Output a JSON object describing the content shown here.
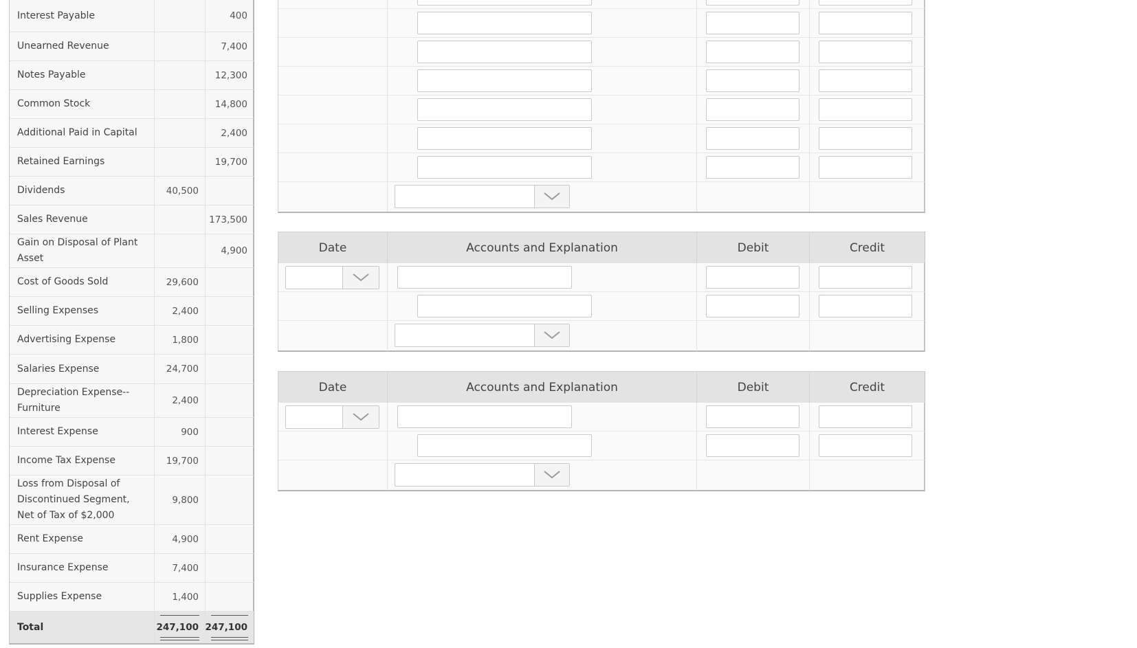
{
  "trial_balance": {
    "rows": [
      {
        "name": "Interest Payable",
        "debit": "",
        "credit": "400"
      },
      {
        "name": "Unearned Revenue",
        "debit": "",
        "credit": "7,400"
      },
      {
        "name": "Notes Payable",
        "debit": "",
        "credit": "12,300"
      },
      {
        "name": "Common Stock",
        "debit": "",
        "credit": "14,800"
      },
      {
        "name": "Additional Paid in Capital",
        "debit": "",
        "credit": "2,400"
      },
      {
        "name": "Retained Earnings",
        "debit": "",
        "credit": "19,700"
      },
      {
        "name": "Dividends",
        "debit": "40,500",
        "credit": ""
      },
      {
        "name": "Sales Revenue",
        "debit": "",
        "credit": "173,500"
      },
      {
        "name": "Gain on Disposal of Plant Asset",
        "debit": "",
        "credit": "4,900"
      },
      {
        "name": "Cost of Goods Sold",
        "debit": "29,600",
        "credit": ""
      },
      {
        "name": "Selling Expenses",
        "debit": "2,400",
        "credit": ""
      },
      {
        "name": "Advertising Expense",
        "debit": "1,800",
        "credit": ""
      },
      {
        "name": "Salaries Expense",
        "debit": "24,700",
        "credit": ""
      },
      {
        "name": "Depreciation Expense--Furniture",
        "debit": "2,400",
        "credit": ""
      },
      {
        "name": "Interest Expense",
        "debit": "900",
        "credit": ""
      },
      {
        "name": "Income Tax Expense",
        "debit": "19,700",
        "credit": ""
      },
      {
        "name": "Loss from Disposal of Discontinued Segment, Net of Tax of $2,000",
        "debit": "9,800",
        "credit": ""
      },
      {
        "name": "Rent Expense",
        "debit": "4,900",
        "credit": ""
      },
      {
        "name": "Insurance Expense",
        "debit": "7,400",
        "credit": ""
      },
      {
        "name": "Supplies Expense",
        "debit": "1,400",
        "credit": ""
      }
    ],
    "total": {
      "name": "Total",
      "debit": "247,100",
      "credit": "247,100"
    }
  },
  "journal": {
    "headers": {
      "date": "Date",
      "accounts": "Accounts and Explanation",
      "debit": "Debit",
      "credit": "Credit"
    }
  }
}
